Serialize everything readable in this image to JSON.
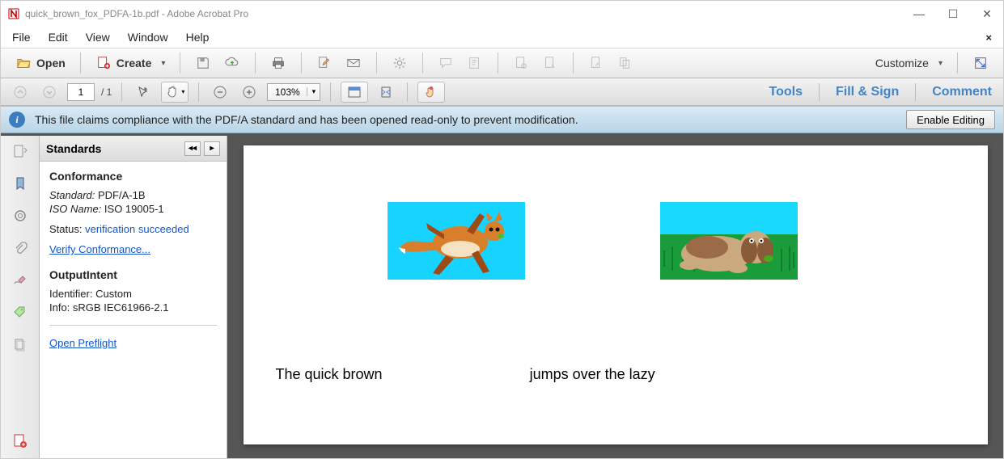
{
  "window": {
    "title": "quick_brown_fox_PDFA-1b.pdf - Adobe Acrobat Pro"
  },
  "menu": {
    "file": "File",
    "edit": "Edit",
    "view": "View",
    "window": "Window",
    "help": "Help"
  },
  "toolbar1": {
    "open": "Open",
    "create": "Create",
    "customize": "Customize"
  },
  "toolbar2": {
    "page_current": "1",
    "page_total": "/  1",
    "zoom": "103%"
  },
  "right_actions": {
    "tools": "Tools",
    "fill": "Fill & Sign",
    "comment": "Comment"
  },
  "infobar": {
    "text": "This file claims compliance with the PDF/A standard and has been opened read-only to prevent modification.",
    "button": "Enable Editing"
  },
  "sidepanel": {
    "title": "Standards",
    "conf_header": "Conformance",
    "standard_lbl": "Standard:",
    "standard_val": "PDF/A-1B",
    "iso_lbl": "ISO Name:",
    "iso_val": "ISO 19005-1",
    "status_lbl": "Status:",
    "status_val": "verification succeeded",
    "verify_link": "Verify Conformance...",
    "oi_header": "OutputIntent",
    "identifier_lbl": "Identifier:",
    "identifier_val": "Custom",
    "info_lbl": "Info:",
    "info_val": "sRGB IEC61966-2.1",
    "preflight_link": "Open Preflight"
  },
  "document": {
    "text1": "The quick brown",
    "text2": "jumps over the lazy"
  }
}
